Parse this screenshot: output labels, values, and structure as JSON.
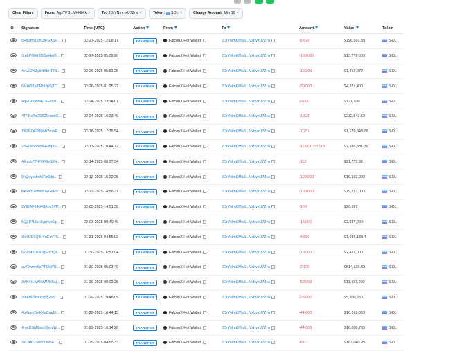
{
  "filters": {
    "clear_label": "Clear Filters",
    "from_label": "From:",
    "from_value": "AgsYPS...VHHHrk",
    "to_label": "To:",
    "to_value": "2DrYNm...xU7Znv",
    "token_label": "Token:",
    "token_value": "SOL",
    "change_label": "Change Amount:",
    "change_value": "Min 10",
    "remove_icon": "close-icon"
  },
  "table": {
    "headers": {
      "signature": "Signature",
      "time": "Time (UTC)",
      "action": "Action",
      "from": "From",
      "to": "To",
      "amount": "Amount",
      "value": "Value",
      "token": "Token"
    },
    "rows": [
      {
        "sig": "5Rx2rf8TZhDfPGX5H...",
        "time": "02-27-2025 12:08:17",
        "action": "TRANSFER",
        "from": "FalconX Hot Wallet",
        "to": "2DrYNmKMaS...VxbvxU7Znv",
        "amount": "-5,679",
        "value": "$796,593.33",
        "token": "SOL"
      },
      {
        "sig": "3reLPfEWfBh5sHwM...",
        "time": "02-27-2025 05:09:20",
        "action": "TRANSFER",
        "from": "FalconX Hot Wallet",
        "to": "2DrYNmKMaS...VxbvxU7Znv",
        "amount": "-100,000",
        "value": "$13,776,000",
        "token": "SOL"
      },
      {
        "sig": "4eUd2XZybNKbHFRi...",
        "time": "02-26-2025 05:51:25",
        "action": "TRANSFER",
        "from": "FalconX Hot Wallet",
        "to": "2DrYNmKMaS...VxbvxU7Znv",
        "amount": "-10,200",
        "value": "$1,452,072",
        "token": "SOL"
      },
      {
        "sig": "5MtX32pTABiUpSjTC...",
        "time": "02-26-2025 01:25:22",
        "action": "TRANSFER",
        "from": "FalconX Hot Wallet",
        "to": "2DrYNmKMaS...VxbvxU7Znv",
        "amount": "-30,000",
        "value": "$4,271,400",
        "token": "SOL"
      },
      {
        "sig": "4q6zRtcAMELeFxqU...",
        "time": "02-24-2025 23:14:07",
        "action": "TRANSFER",
        "from": "FalconX Hot Wallet",
        "to": "2DrYNmKMaS...VxbvxU7Znv",
        "amount": "-5,000",
        "value": "$721,100",
        "token": "SOL"
      },
      {
        "sig": "4TFNs4oESZZ9rancG...",
        "time": "02-24-2025 16:23:46",
        "action": "TRANSFER",
        "from": "FalconX Hot Wallet",
        "to": "2DrYNmKMaS...VxbvxU7Znv",
        "amount": "-1,528",
        "value": "$232,943.59",
        "token": "SOL"
      },
      {
        "sig": "TKZKQF2fNsW7mwE...",
        "time": "02-18-2025 17:35:54",
        "action": "TRANSFER",
        "from": "FalconX Hot Wallet",
        "to": "2DrYNmKMaS...VxbvxU7Znv",
        "amount": "-7,257",
        "value": "$1,179,843.06",
        "token": "SOL"
      },
      {
        "sig": "2oHLeo5BvoHEsqXE...",
        "time": "02-17-2025 10:44:12",
        "action": "TRANSFER",
        "from": "FalconX Hot Wallet",
        "to": "2DrYNmKMaS...VxbvxU7Znv",
        "amount": "-11,901.395113",
        "value": "$2,186,881.35",
        "token": "SOL"
      },
      {
        "sig": "44uUv7PrFXFGvSJH...",
        "time": "02-14-2025 00:07:34",
        "action": "TRANSFER",
        "from": "FalconX Hot Wallet",
        "to": "2DrYNmKMaS...VxbvxU7Znv",
        "amount": "-112",
        "value": "$21,773.92",
        "token": "SOL"
      },
      {
        "sig": "5hQuyedmM7wSdp...",
        "time": "02-12-2025 15:22:25",
        "action": "TRANSFER",
        "from": "FalconX Hot Wallet",
        "to": "2DrYNmKMaS...VxbvxU7Znv",
        "amount": "-100,000",
        "value": "$19,192,000",
        "token": "SOL"
      },
      {
        "sig": "KkVx3Gcns8DPGoRo...",
        "time": "02-12-2025 14:56:37",
        "action": "TRANSFER",
        "from": "FalconX Hot Wallet",
        "to": "2DrYNmKMaS...VxbvxU7Znv",
        "amount": "-100,000",
        "value": "$19,222,000",
        "token": "SOL"
      },
      {
        "sig": "2YIEAFjhKHUAby5VP...",
        "time": "02-05-2025 14:51:58",
        "action": "TRANSFER",
        "from": "FalconX Hot Wallet",
        "to": "2DrYNmKMaS...VxbvxU7Znv",
        "amount": "-100",
        "value": "$20,697",
        "token": "SOL"
      },
      {
        "sig": "5QjHP15kuKgrhvx6q...",
        "time": "02-03-2025 09:40:49",
        "action": "TRANSFER",
        "from": "FalconX Hot Wallet",
        "to": "2DrYNmKMaS...VxbvxU7Znv",
        "amount": "-15,000",
        "value": "$2,937,000",
        "token": "SOL"
      },
      {
        "sig": "3bKCD6QJuYnEcVT5...",
        "time": "01-31-2025 04:55:03",
        "action": "TRANSFER",
        "from": "FalconX Hot Wallet",
        "to": "2DrYNmKMaS...VxbvxU7Znv",
        "amount": "-4,590",
        "value": "$1,082,138.4",
        "token": "SOL"
      },
      {
        "sig": "5kVSKGUN9gEhztQ6...",
        "time": "01-30-2025 16:51:04",
        "action": "TRANSFER",
        "from": "FalconX Hot Wallet",
        "to": "2DrYNmKMaS...VxbvxU7Znv",
        "amount": "-10,000",
        "value": "$2,421,000",
        "token": "SOL"
      },
      {
        "sig": "av79rwmXoPTEkWR...",
        "time": "01-30-2025 05:03:49",
        "action": "TRANSFER",
        "from": "FalconX Hot Wallet",
        "to": "2DrYNmKMaS...VxbvxU7Znv",
        "amount": "-2,130",
        "value": "$514,139.39",
        "token": "SOL"
      },
      {
        "sig": "3YKYrLwAh9WJkTsq...",
        "time": "01-30-2025 00:03:25",
        "action": "TRANSFER",
        "from": "FalconX Hot Wallet",
        "to": "2DrYNmKMaS...VxbvxU7Znv",
        "amount": "-50,000",
        "value": "$11,437,000",
        "token": "SOL"
      },
      {
        "sig": "39mMZnwjzoipg255...",
        "time": "01-29-2025 19:48:05",
        "action": "TRANSFER",
        "from": "FalconX Hot Wallet",
        "to": "2DrYNmKMaS...VxbvxU7Znv",
        "amount": "-25,000",
        "value": "$5,800,250",
        "token": "SOL"
      },
      {
        "sig": "4uKpyv2mKKuCaeBt...",
        "time": "01-29-2025 16:44:15",
        "action": "TRANSFER",
        "from": "FalconX Hot Wallet",
        "to": "2DrYNmKMaS...VxbvxU7Znv",
        "amount": "-44,000",
        "value": "$10,018,360",
        "token": "SOL"
      },
      {
        "sig": "4rocDSM6viioXhovW...",
        "time": "01-29-2025 16:14:28",
        "action": "TRANSFER",
        "from": "FalconX Hot Wallet",
        "to": "2DrYNmKMaS...VxbvxU7Znv",
        "amount": "-44,000",
        "value": "$10,000,760",
        "token": "SOL"
      },
      {
        "sig": "32UkKtX5oniJ3wsE...",
        "time": "01-29-2025 04:55:33",
        "action": "TRANSFER",
        "from": "FalconX Hot Wallet",
        "to": "2DrYNmKMaS...VxbvxU7Znv",
        "amount": "-811",
        "value": "$187,040.93",
        "token": "SOL"
      }
    ]
  },
  "colors": {
    "accent": "#1e7fd8",
    "negative": "#e5484d",
    "badge": "#1e7fd8"
  }
}
